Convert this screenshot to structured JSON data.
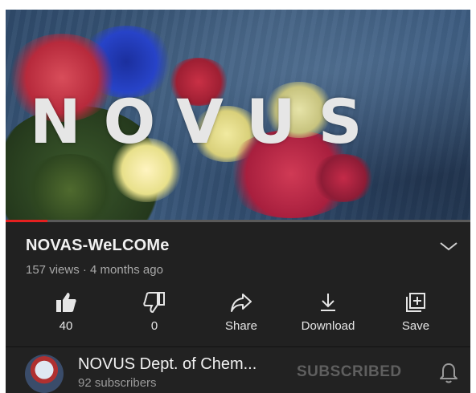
{
  "video": {
    "thumbnail_title": "NOVUS",
    "progress_fraction": 0.09
  },
  "details": {
    "title": "NOVAS-WeLCOMe",
    "meta": "157 views · 4 months ago"
  },
  "actions": [
    {
      "icon": "thumbs-up-icon",
      "label": "40"
    },
    {
      "icon": "thumbs-down-icon",
      "label": "0"
    },
    {
      "icon": "share-icon",
      "label": "Share"
    },
    {
      "icon": "download-icon",
      "label": "Download"
    },
    {
      "icon": "save-playlist-icon",
      "label": "Save"
    }
  ],
  "channel": {
    "name": "NOVUS Dept. of Chem...",
    "subscribers": "92 subscribers",
    "subscribe_status": "SUBSCRIBED"
  },
  "colors": {
    "background": "#212121",
    "progress": "#e52020",
    "text_primary": "#f1f1f1",
    "text_secondary": "#a8a8a8"
  }
}
